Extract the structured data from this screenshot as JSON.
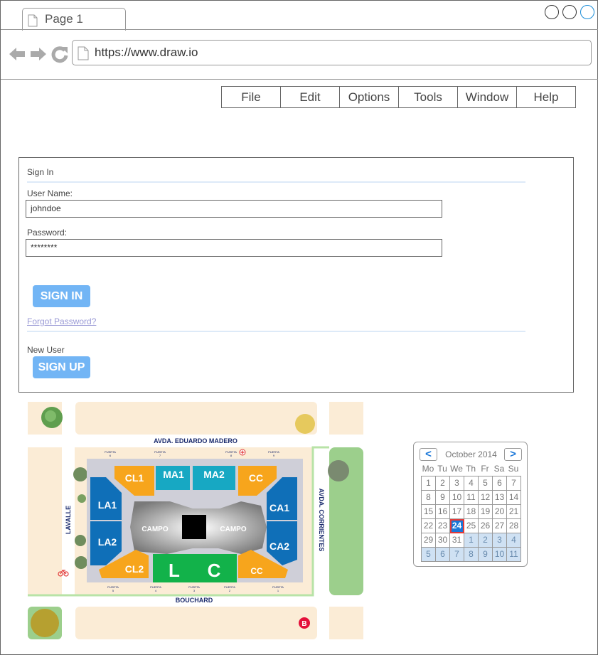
{
  "browser": {
    "tab_label": "Page 1",
    "url": "https://www.draw.io",
    "nav_icons": [
      "back-arrow-icon",
      "forward-arrow-icon",
      "reload-icon"
    ],
    "window_buttons": [
      "minimize-circle",
      "maximize-circle",
      "close-circle"
    ]
  },
  "menu": {
    "items": [
      {
        "label": "File"
      },
      {
        "label": "Edit"
      },
      {
        "label": "Options"
      },
      {
        "label": "Tools"
      },
      {
        "label": "Window"
      },
      {
        "label": "Help"
      }
    ]
  },
  "signin": {
    "title": "Sign In",
    "username_label": "User Name:",
    "username_value": "johndoe",
    "password_label": "Password:",
    "password_value": "********",
    "signin_button": "SIGN IN",
    "forgot_link": "Forgot Password?",
    "new_user_label": "New User",
    "signup_button": "SIGN UP"
  },
  "map": {
    "streets": {
      "top": "AVDA. EDUARDO MADERO",
      "bottom": "BOUCHARD",
      "left": "LAVALLE",
      "right": "AVDA. CORRIENTES"
    },
    "gates_top": [
      {
        "label": "PUERTA",
        "num": "6"
      },
      {
        "label": "PUERTA",
        "num": "7"
      },
      {
        "label": "PUERTA",
        "num": "8"
      },
      {
        "label": "PUERTA",
        "num": "9"
      }
    ],
    "gates_bottom": [
      {
        "label": "PUERTA",
        "num": "5"
      },
      {
        "label": "PUERTA",
        "num": "4"
      },
      {
        "label": "PUERTA",
        "num": "3"
      },
      {
        "label": "PUERTA",
        "num": "2"
      },
      {
        "label": "PUERTA",
        "num": "1"
      }
    ],
    "sections": {
      "cl1": "CL1",
      "ma1": "MA1",
      "ma2": "MA2",
      "cc_top": "CC",
      "la1": "LA1",
      "la2": "LA2",
      "ca1": "CA1",
      "ca2": "CA2",
      "campo_left": "CAMPO",
      "campo_right": "CAMPO",
      "cl2": "CL2",
      "cc_bottom": "CC",
      "l": "L",
      "c": "C"
    },
    "marker": "B",
    "colors": {
      "orange": "#f7a51c",
      "teal": "#17a8c3",
      "blue": "#0f6fb8",
      "green": "#12b24a",
      "gray": "#8c8c8c",
      "street_label": "#1a2a6c",
      "block": "#fbecd6",
      "park": "#9ccf8c"
    }
  },
  "calendar": {
    "month_label": "October 2014",
    "prev": "<",
    "next": ">",
    "weekdays": [
      "Mo",
      "Tu",
      "We",
      "Th",
      "Fr",
      "Sa",
      "Su"
    ],
    "days": [
      "1",
      "2",
      "3",
      "4",
      "5",
      "6",
      "7",
      "8",
      "9",
      "10",
      "11",
      "12",
      "13",
      "14",
      "15",
      "16",
      "17",
      "18",
      "19",
      "20",
      "21",
      "22",
      "23",
      "24",
      "25",
      "26",
      "27",
      "28",
      "29",
      "30",
      "31",
      "1",
      "2",
      "3",
      "4",
      "5",
      "6",
      "7",
      "8",
      "9",
      "10",
      "11"
    ],
    "selected": "24",
    "next_month_start_index": 31,
    "colors": {
      "selected": "#1a77d8",
      "next_month": "#cfe1f3"
    }
  }
}
